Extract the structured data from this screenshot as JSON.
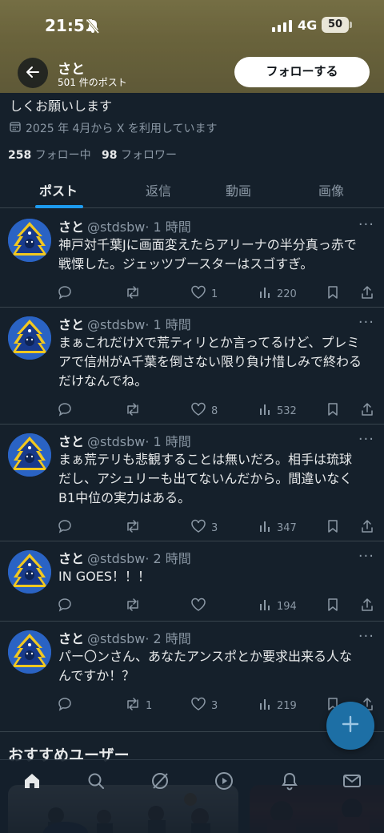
{
  "status_bar": {
    "time": "21:51",
    "network": "4G",
    "battery": "50"
  },
  "header": {
    "name": "さと",
    "post_count": "501 件のポスト",
    "follow_label": "フォローする"
  },
  "profile": {
    "bio_tail": "しくお願いします",
    "joined": "2025 年 4月から X を利用しています",
    "following_count": "258",
    "following_label": "フォロー中",
    "followers_count": "98",
    "followers_label": "フォロワー"
  },
  "tabs": [
    {
      "label": "ポスト",
      "active": true
    },
    {
      "label": "返信",
      "active": false
    },
    {
      "label": "動画",
      "active": false
    },
    {
      "label": "画像",
      "active": false
    }
  ],
  "posts": [
    {
      "name": "さと",
      "handle": "@stdsbw",
      "time": "· 1 時間",
      "lines": [
        "神戸対千葉Jに画面変えたらアリーナの半分真っ赤で",
        "戦慄した。ジェッツブースターはスゴすぎ。"
      ],
      "replies": "",
      "reposts": "",
      "likes": "1",
      "views": "220"
    },
    {
      "name": "さと",
      "handle": "@stdsbw",
      "time": "· 1 時間",
      "lines": [
        "まぁこれだけXで荒ティリとか言ってるけど、プレミ",
        "アで信州がA千葉を倒さない限り負け惜しみで終わる",
        "だけなんでね。"
      ],
      "replies": "",
      "reposts": "",
      "likes": "8",
      "views": "532"
    },
    {
      "name": "さと",
      "handle": "@stdsbw",
      "time": "· 1 時間",
      "lines": [
        "まぁ荒テリも悲観することは無いだろ。相手は琉球",
        "だし、アシュリーも出てないんだから。間違いなく",
        "B1中位の実力はある。"
      ],
      "replies": "",
      "reposts": "",
      "likes": "3",
      "views": "347"
    },
    {
      "name": "さと",
      "handle": "@stdsbw",
      "time": "· 2 時間",
      "lines": [
        "IN GOES！！！"
      ],
      "replies": "",
      "reposts": "",
      "likes": "",
      "views": "194"
    },
    {
      "name": "さと",
      "handle": "@stdsbw",
      "time": "· 2 時間",
      "lines": [
        "パー〇ンさん、あなたアンスポとか要求出来る人な",
        "んですか！？"
      ],
      "replies": "",
      "reposts": "1",
      "likes": "3",
      "views": "219"
    }
  ],
  "recommended": {
    "title": "おすすめユーザー"
  },
  "icons": {
    "back": "arrow-left-icon",
    "bell_off": "bell-slash-icon",
    "calendar": "calendar-icon",
    "reply": "comment-icon",
    "repost": "repost-icon",
    "like": "heart-icon",
    "views": "bar-chart-icon",
    "bookmark": "bookmark-icon",
    "share": "share-icon",
    "more": "more-icon",
    "compose": "plus-icon",
    "nav": [
      "home-icon",
      "search-icon",
      "grok-icon",
      "video-icon",
      "notifications-icon",
      "messages-icon"
    ]
  },
  "colors": {
    "accent": "#1d9bf0",
    "background": "#15202b",
    "secondary_text": "#8b98a5",
    "header_banner": "#7d7546"
  }
}
